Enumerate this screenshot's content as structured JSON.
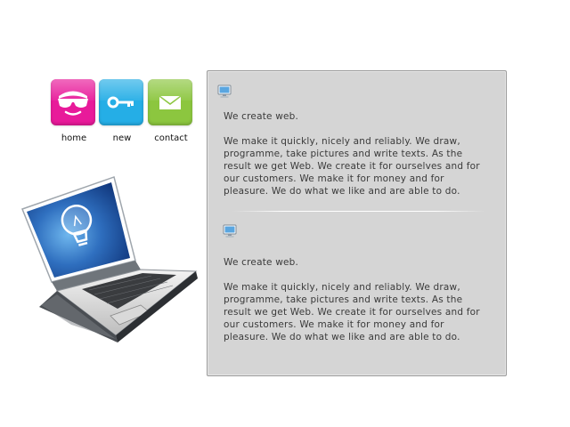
{
  "nav": {
    "items": [
      {
        "label": "home",
        "icon": "sunglasses-face-icon",
        "color": "#e81a9a"
      },
      {
        "label": "new",
        "icon": "key-icon",
        "color": "#25aee6"
      },
      {
        "label": "contact",
        "icon": "envelope-icon",
        "color": "#8cc63f"
      }
    ]
  },
  "hero": {
    "icon": "laptop-lightbulb-icon"
  },
  "posts": [
    {
      "icon": "monitor-icon",
      "heading": "We create web.",
      "body": "We make it quickly, nicely and reliably. We draw, programme, take pictures and write texts. As the result we get Web. We create it for ourselves and for our customers. We make it for money and for pleasure. We do what we like and are able to do."
    },
    {
      "icon": "monitor-icon",
      "heading": "We create web.",
      "body": "We make it quickly, nicely and reliably. We draw, programme, take pictures and write texts. As the result we get Web. We create it for ourselves and for our customers. We make it for money and for pleasure. We do what we like and are able to do."
    }
  ]
}
